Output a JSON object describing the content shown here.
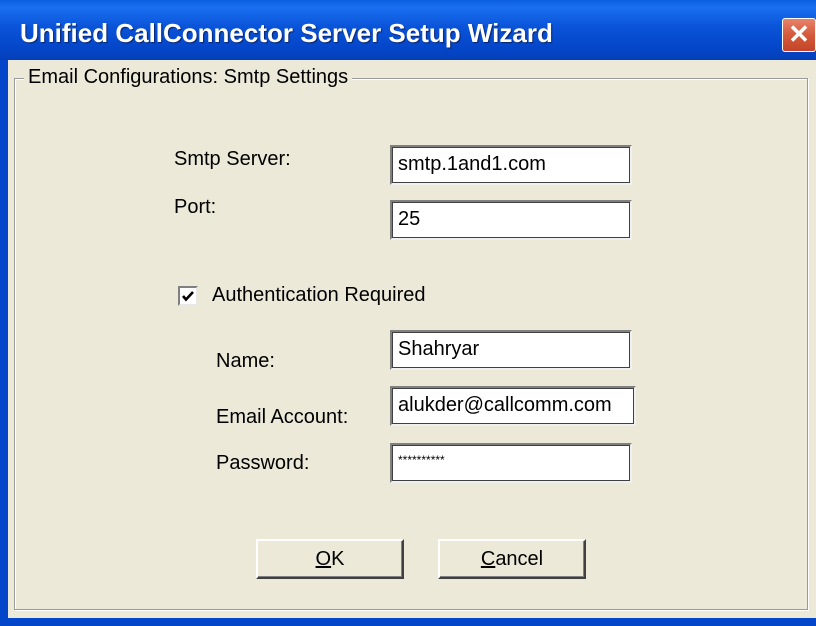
{
  "window": {
    "title": "Unified CallConnector Server Setup Wizard",
    "close_glyph": "✕"
  },
  "group": {
    "label": "Email Configurations:  Smtp Settings"
  },
  "smtp": {
    "server_label": "Smtp Server:",
    "server_value": "smtp.1and1.com",
    "port_label": "Port:",
    "port_value": "25"
  },
  "auth": {
    "checkbox_label": "Authentication Required",
    "checked": true,
    "name_label": "Name:",
    "name_value": "Shahryar",
    "email_label": "Email Account:",
    "email_value": "alukder@callcomm.com",
    "password_label": "Password:",
    "password_value": "**********"
  },
  "buttons": {
    "ok_mnemonic": "O",
    "ok_rest": "K",
    "cancel_mnemonic": "C",
    "cancel_rest": "ancel"
  }
}
